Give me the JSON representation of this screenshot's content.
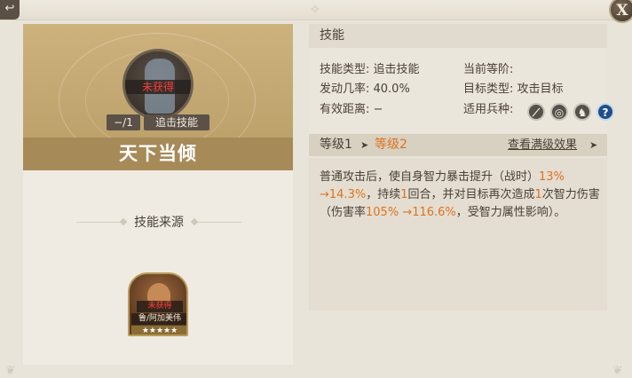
{
  "colors": {
    "highlight": "#e0731c",
    "locked_red": "#ff3b33",
    "panel_gold": "#a68a58",
    "text": "#4a4036"
  },
  "window": {
    "back_icon": "back-arrow-icon",
    "close_label": "X"
  },
  "skill": {
    "status": "未获得",
    "level": "−/1",
    "type_tag": "追击技能",
    "name": "天下当倾"
  },
  "source": {
    "title": "技能来源",
    "hero": {
      "status": "未获得",
      "name": "鲁/阿加美伟",
      "stars": "★★★★★"
    }
  },
  "info": {
    "header": "技能",
    "rows": {
      "skill_type": "技能类型: 追击技能",
      "trigger_rate": "发动几率: 40.0%",
      "range": "有效距离: −",
      "current_level": "当前等阶:",
      "target_type": "目标类型: 攻击目标",
      "troop_type": "适用兵种:"
    },
    "troop_icons": [
      "sword-icon",
      "target-icon",
      "horse-icon",
      "question-icon"
    ]
  },
  "levels": {
    "level1": "等级1",
    "separator": "➤",
    "level2": "等级2",
    "view_max": "查看满级效果",
    "view_max_arrow": "➤"
  },
  "description": {
    "p1": "普通攻击后，使自身智力暴击提升（战时）",
    "v1": "13% →14.3%",
    "p2": "，持续",
    "v2": "1",
    "p3": "回合，并对目标再次造成",
    "v3": "1",
    "p4": "次智力伤害（伤害率",
    "v4": "105% →116.6%",
    "p5": "，受智力属性影响）。"
  }
}
